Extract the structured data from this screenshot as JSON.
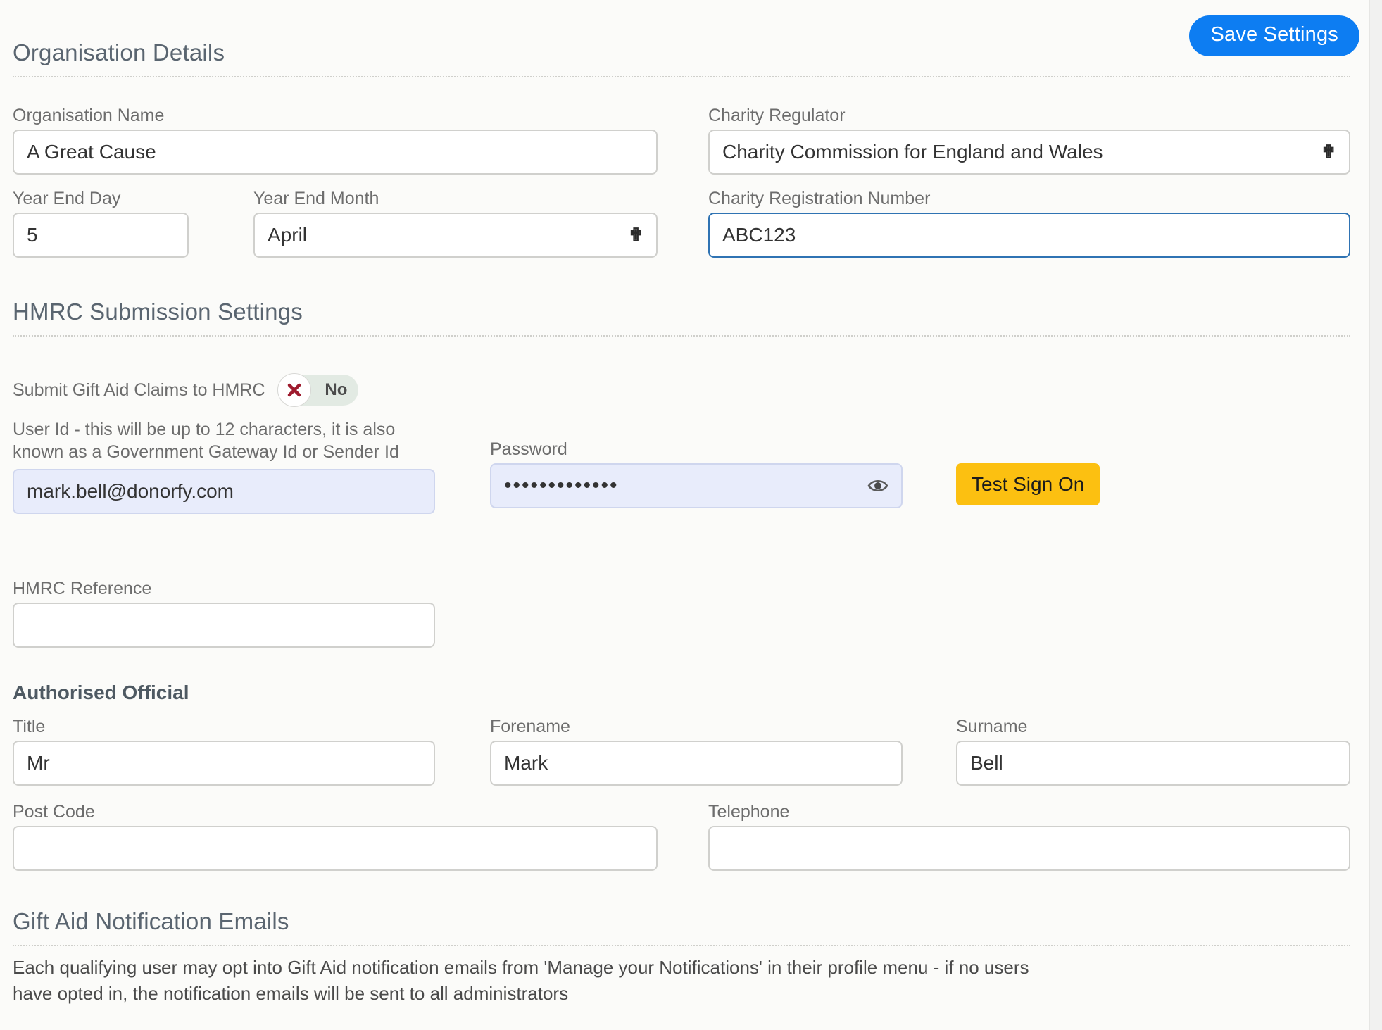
{
  "toolbar": {
    "save_label": "Save Settings",
    "save_color": "#0d7df2"
  },
  "sections": {
    "organisation": {
      "title": "Organisation Details",
      "fields": {
        "org_name": {
          "label": "Organisation Name",
          "value": "A Great Cause"
        },
        "year_end_day": {
          "label": "Year End Day",
          "value": "5"
        },
        "year_end_month": {
          "label": "Year End Month",
          "value": "April"
        },
        "charity_regulator": {
          "label": "Charity Regulator",
          "value": "Charity Commission for England and Wales"
        },
        "charity_reg_number": {
          "label": "Charity Registration Number",
          "value": "ABC123"
        }
      }
    },
    "hmrc": {
      "title": "HMRC Submission Settings",
      "submit_claims": {
        "label": "Submit Gift Aid Claims to HMRC",
        "toggle_value": "No",
        "toggle_icon": "cross-icon"
      },
      "user_id": {
        "label": "User Id - this will be up to 12 characters, it is also known as a Government Gateway Id or Sender Id",
        "value": "mark.bell@donorfy.com"
      },
      "password": {
        "label": "Password",
        "value": "•••••••••••••",
        "reveal_icon": "eye-icon"
      },
      "test_sign_on": {
        "label": "Test Sign On",
        "color": "#fcc011"
      },
      "hmrc_reference": {
        "label": "HMRC Reference",
        "value": ""
      },
      "authorised_official": {
        "heading": "Authorised Official",
        "title": {
          "label": "Title",
          "value": "Mr"
        },
        "forename": {
          "label": "Forename",
          "value": "Mark"
        },
        "surname": {
          "label": "Surname",
          "value": "Bell"
        },
        "post_code": {
          "label": "Post Code",
          "value": ""
        },
        "telephone": {
          "label": "Telephone",
          "value": ""
        }
      }
    },
    "notifications": {
      "title": "Gift Aid Notification Emails",
      "description": "Each qualifying user may opt into Gift Aid notification emails from 'Manage your Notifications' in their profile menu - if no users have opted in, the notification emails will be sent to all administrators"
    }
  }
}
